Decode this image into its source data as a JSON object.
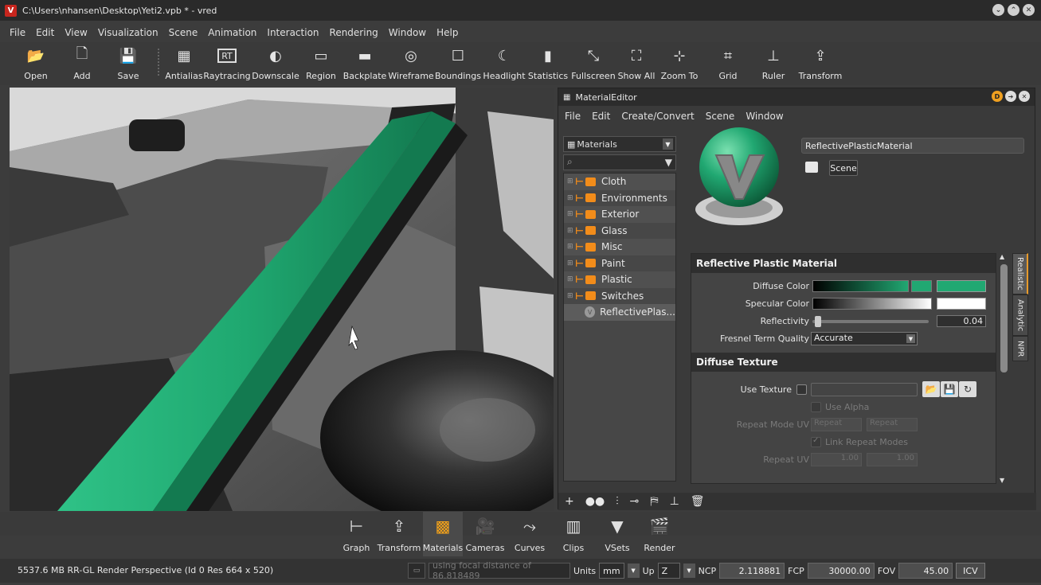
{
  "window": {
    "title": "C:\\Users\\nhansen\\Desktop\\Yeti2.vpb * - vred",
    "logo": "V"
  },
  "menu": [
    "File",
    "Edit",
    "View",
    "Visualization",
    "Scene",
    "Animation",
    "Interaction",
    "Rendering",
    "Window",
    "Help"
  ],
  "toolbar": [
    {
      "label": "Open",
      "icon": "folder-icon"
    },
    {
      "label": "Add",
      "icon": "add-file-icon"
    },
    {
      "label": "Save",
      "icon": "floppy-icon"
    },
    {
      "label": "Antialias",
      "icon": "antialias-icon"
    },
    {
      "label": "Raytracing",
      "icon": "rt-icon",
      "text": "RT"
    },
    {
      "label": "Downscale",
      "icon": "downscale-icon"
    },
    {
      "label": "Region",
      "icon": "region-icon"
    },
    {
      "label": "Backplate",
      "icon": "backplate-icon"
    },
    {
      "label": "Wireframe",
      "icon": "wireframe-icon"
    },
    {
      "label": "Boundings",
      "icon": "boundings-icon"
    },
    {
      "label": "Headlight",
      "icon": "headlight-icon"
    },
    {
      "label": "Statistics",
      "icon": "statistics-icon"
    },
    {
      "label": "Fullscreen",
      "icon": "fullscreen-icon"
    },
    {
      "label": "Show All",
      "icon": "show-all-icon"
    },
    {
      "label": "Zoom To",
      "icon": "zoom-to-icon"
    },
    {
      "label": "Grid",
      "icon": "grid-icon"
    },
    {
      "label": "Ruler",
      "icon": "ruler-icon"
    },
    {
      "label": "Transform",
      "icon": "transform-icon"
    }
  ],
  "material_editor": {
    "title": "MaterialEditor",
    "menu": [
      "File",
      "Edit",
      "Create/Convert",
      "Scene",
      "Window"
    ],
    "dropdown": "Materials",
    "tree": [
      {
        "label": "Cloth"
      },
      {
        "label": "Environments"
      },
      {
        "label": "Exterior"
      },
      {
        "label": "Glass"
      },
      {
        "label": "Misc"
      },
      {
        "label": "Paint"
      },
      {
        "label": "Plastic"
      },
      {
        "label": "Switches"
      }
    ],
    "selected_material": "ReflectivePlas...",
    "material_name": "ReflectivePlasticMaterial",
    "scene_button": "Scene",
    "section1": "Reflective Plastic Material",
    "diffuse_label": "Diffuse Color",
    "diffuse_color": "#21a872",
    "specular_label": "Specular Color",
    "specular_color": "#ffffff",
    "reflectivity_label": "Reflectivity",
    "reflectivity_value": "0.04",
    "fresnel_label": "Fresnel Term Quality",
    "fresnel_value": "Accurate",
    "section2": "Diffuse Texture",
    "use_texture_label": "Use Texture",
    "use_alpha_label": "Use Alpha",
    "repeat_mode_label": "Repeat Mode UV",
    "repeat_u": "Repeat",
    "repeat_v": "Repeat",
    "link_repeat_label": "Link Repeat Modes",
    "repeat_uv_label": "Repeat UV",
    "repeat_uv_u": "1.00",
    "repeat_uv_v": "1.00",
    "tabs": [
      "Realistic",
      "Analytic",
      "NPR"
    ]
  },
  "modules": [
    {
      "label": "Graph",
      "icon": "graph-icon"
    },
    {
      "label": "Transform",
      "icon": "transform-module-icon"
    },
    {
      "label": "Materials",
      "icon": "materials-icon",
      "active": true
    },
    {
      "label": "Cameras",
      "icon": "cameras-icon"
    },
    {
      "label": "Curves",
      "icon": "curves-icon"
    },
    {
      "label": "Clips",
      "icon": "clips-icon"
    },
    {
      "label": "VSets",
      "icon": "vsets-icon"
    },
    {
      "label": "Render",
      "icon": "render-icon"
    }
  ],
  "status": {
    "info": "5537.6 MB  RR-GL  Render Perspective (Id 0 Res 664 x 520)",
    "focal": "using focal distance of 86.818489",
    "units_label": "Units",
    "units_value": "mm",
    "up_label": "Up",
    "up_value": "Z",
    "ncp_label": "NCP",
    "ncp_value": "2.118881",
    "fcp_label": "FCP",
    "fcp_value": "30000.00",
    "fov_label": "FOV",
    "fov_value": "45.00",
    "icv_label": "ICV"
  }
}
